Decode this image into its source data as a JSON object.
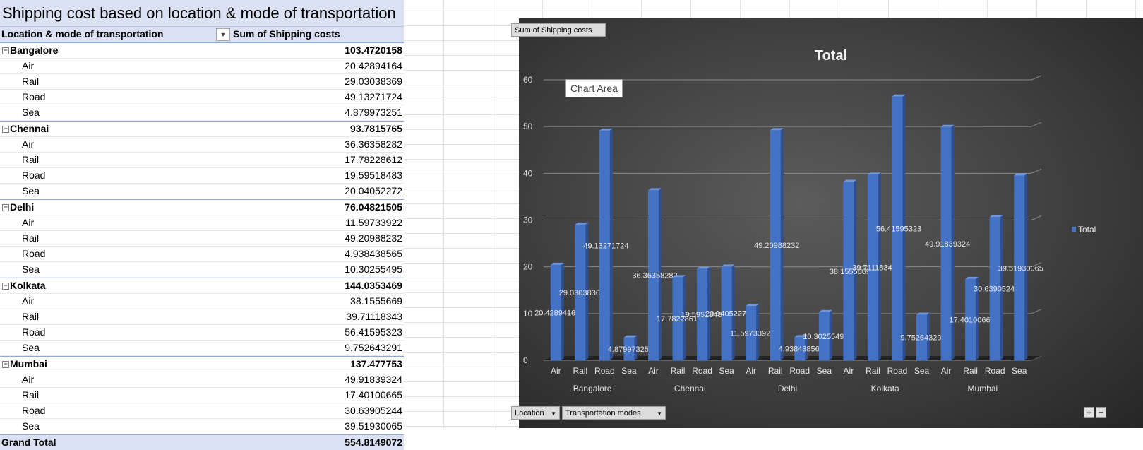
{
  "pivot": {
    "title": "Shipping cost based on location & mode of transportation",
    "header_label": "Location & mode of transportation",
    "header_value": "Sum of Shipping costs",
    "filter_icon": "dropdown-arrow-icon",
    "groups": [
      {
        "name": "Bangalore",
        "total": "103.4720158",
        "items": [
          {
            "mode": "Air",
            "value": "20.42894164"
          },
          {
            "mode": "Rail",
            "value": "29.03038369"
          },
          {
            "mode": "Road",
            "value": "49.13271724"
          },
          {
            "mode": "Sea",
            "value": "4.879973251"
          }
        ]
      },
      {
        "name": "Chennai",
        "total": "93.7815765",
        "items": [
          {
            "mode": "Air",
            "value": "36.36358282"
          },
          {
            "mode": "Rail",
            "value": "17.78228612"
          },
          {
            "mode": "Road",
            "value": "19.59518483"
          },
          {
            "mode": "Sea",
            "value": "20.04052272"
          }
        ]
      },
      {
        "name": "Delhi",
        "total": "76.04821505",
        "items": [
          {
            "mode": "Air",
            "value": "11.59733922"
          },
          {
            "mode": "Rail",
            "value": "49.20988232"
          },
          {
            "mode": "Road",
            "value": "4.938438565"
          },
          {
            "mode": "Sea",
            "value": "10.30255495"
          }
        ]
      },
      {
        "name": "Kolkata",
        "total": "144.0353469",
        "items": [
          {
            "mode": "Air",
            "value": "38.1555669"
          },
          {
            "mode": "Rail",
            "value": "39.71118343"
          },
          {
            "mode": "Road",
            "value": "56.41595323"
          },
          {
            "mode": "Sea",
            "value": "9.752643291"
          }
        ]
      },
      {
        "name": "Mumbai",
        "total": "137.477753",
        "items": [
          {
            "mode": "Air",
            "value": "49.91839324"
          },
          {
            "mode": "Rail",
            "value": "17.40100665"
          },
          {
            "mode": "Road",
            "value": "30.63905244"
          },
          {
            "mode": "Sea",
            "value": "39.51930065"
          }
        ]
      }
    ],
    "grand_total_label": "Grand Total",
    "grand_total_value": "554.8149072"
  },
  "chart_ui": {
    "values_button": "Sum of Shipping costs",
    "axis_button_1": "Location",
    "axis_button_2": "Transportation modes",
    "tooltip": "Chart Area",
    "zoom_in": "+",
    "zoom_out": "−"
  },
  "colors": {
    "bar": "#4472c4",
    "pivot_header": "#d9e1f2"
  },
  "chart_data": {
    "type": "bar",
    "title": "Total",
    "ylim": [
      0,
      60
    ],
    "yticks": [
      0,
      10,
      20,
      30,
      40,
      50,
      60
    ],
    "groups": [
      "Bangalore",
      "Chennai",
      "Delhi",
      "Kolkata",
      "Mumbai"
    ],
    "categories": [
      "Air",
      "Rail",
      "Road",
      "Sea",
      "Air",
      "Rail",
      "Road",
      "Sea",
      "Air",
      "Rail",
      "Road",
      "Sea",
      "Air",
      "Rail",
      "Road",
      "Sea",
      "Air",
      "Rail",
      "Road",
      "Sea"
    ],
    "series": [
      {
        "name": "Total",
        "values": [
          20.42894164,
          29.03038369,
          49.13271724,
          4.879973251,
          36.36358282,
          17.78228612,
          19.59518483,
          20.04052272,
          11.59733922,
          49.20988232,
          4.938438565,
          10.30255495,
          38.1555669,
          39.71118343,
          56.41595323,
          9.752643291,
          49.91839324,
          17.40100665,
          30.63905244,
          39.51930065
        ]
      }
    ],
    "data_labels": [
      "20.42894164",
      "29.03038369",
      "49.13271724",
      "4.879973251",
      "36.36358282",
      "17.78228612",
      "19.59518483",
      "20.04052272",
      "11.59733922",
      "49.20988232",
      "4.938438565",
      "10.30255495",
      "38.1555669",
      "39.71118343",
      "56.41595323",
      "9.752643291",
      "49.91839324",
      "17.40100665",
      "30.63905244",
      "39.51930065"
    ],
    "legend": "right",
    "grid": true
  }
}
